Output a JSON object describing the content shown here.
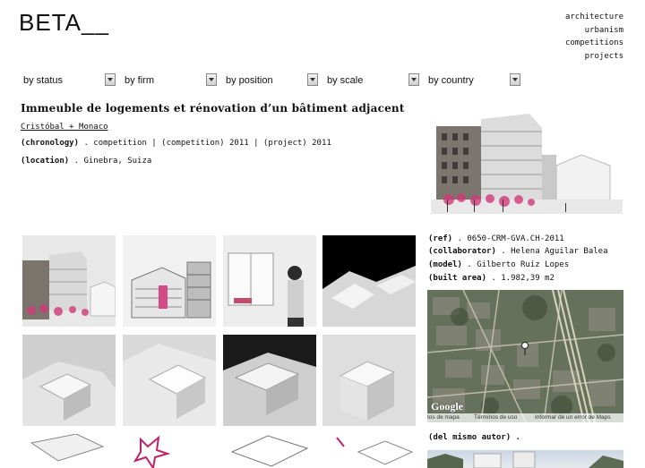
{
  "logo": "BETA__",
  "topnav": [
    "architecture",
    "urbanism",
    "competitions",
    "projects"
  ],
  "filters": [
    "by status",
    "by firm",
    "by position",
    "by scale",
    "by country"
  ],
  "project": {
    "title": "Immeuble de logements et rénovation d’un bâtiment adjacent",
    "author": "Cristóbal + Monaco",
    "chronology_label": "(chronology)",
    "chronology_value": ". competition | (competition) 2011 | (project) 2011",
    "location_label": "(location)",
    "location_value": ". Ginebra, Suiza"
  },
  "details": {
    "ref_label": "(ref)",
    "ref_value": ". 0650-CRM-GVA.CH-2011",
    "collaborator_label": "(collaborator)",
    "collaborator_value": ". Helena Aguilar Balea",
    "model_label": "(model)",
    "model_value": ". Gilberto Ruiz Lopes",
    "area_label": "(built area)",
    "area_value": ". 1.982,39 m2"
  },
  "map": {
    "google": "Google",
    "footer": [
      "tos de mapa",
      "Términos de uso",
      "Informar de un error de Maps"
    ]
  },
  "same_author": "(del mismo autor) ."
}
